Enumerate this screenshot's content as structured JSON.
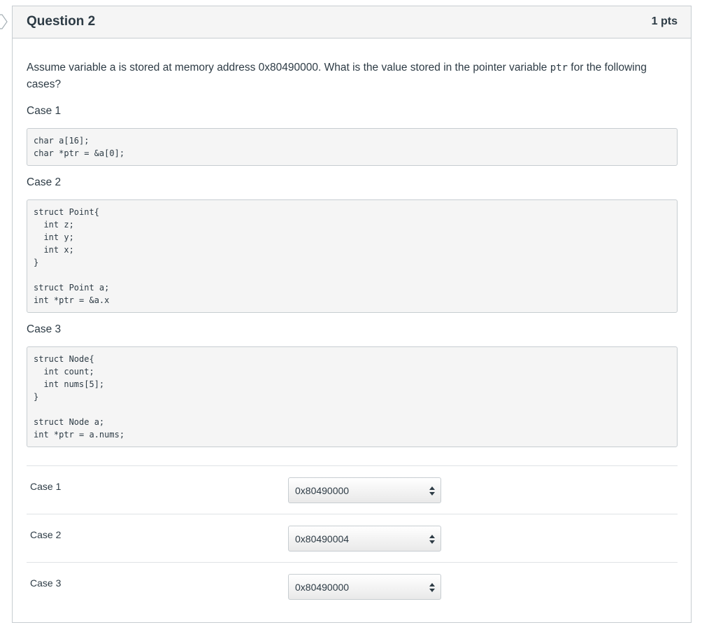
{
  "question": {
    "title": "Question 2",
    "points": "1 pts",
    "prompt_before": "Assume variable a is stored at memory address 0x80490000. What is the value stored in the pointer variable ",
    "prompt_code": "ptr",
    "prompt_after": " for the following cases?",
    "cases": [
      {
        "label": "Case 1",
        "code": "char a[16];\nchar *ptr = &a[0];"
      },
      {
        "label": "Case 2",
        "code": "struct Point{\n  int z;\n  int y;\n  int x;\n}\n\nstruct Point a;\nint *ptr = &a.x"
      },
      {
        "label": "Case 3",
        "code": "struct Node{\n  int count;\n  int nums[5];\n}\n\nstruct Node a;\nint *ptr = a.nums;"
      }
    ]
  },
  "answers": [
    {
      "label": "Case 1",
      "selected": "0x80490000"
    },
    {
      "label": "Case 2",
      "selected": "0x80490004"
    },
    {
      "label": "Case 3",
      "selected": "0x80490000"
    }
  ],
  "icons": {
    "select_arrows": "up-down-arrows-icon",
    "side_marker": "question-marker-icon"
  }
}
